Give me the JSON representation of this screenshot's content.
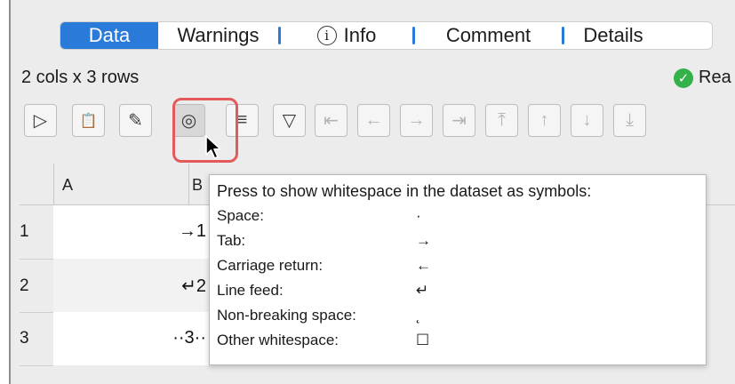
{
  "tabs": [
    {
      "label": "Data",
      "active": true
    },
    {
      "label": "Warnings",
      "active": false
    },
    {
      "label": "Info",
      "active": false
    },
    {
      "label": "Comment",
      "active": false
    },
    {
      "label": "Details",
      "active": false
    }
  ],
  "info_icon_glyph": "i",
  "table_info": "2 cols x 3 rows",
  "status": {
    "text": "Rea",
    "color": "#34b249"
  },
  "toolbar": {
    "buttons": [
      {
        "name": "run-icon",
        "glyph": "▷"
      },
      {
        "name": "paste-add-icon",
        "glyph": "📋"
      },
      {
        "name": "pencil-icon",
        "glyph": "✎"
      },
      {
        "name": "eye-icon",
        "glyph": "◎",
        "pressed": true
      },
      {
        "name": "sort-lines-icon",
        "glyph": "≡"
      },
      {
        "name": "filter-icon",
        "glyph": "▽"
      },
      {
        "name": "first-column-icon",
        "glyph": "⇤"
      },
      {
        "name": "left-arrow-icon",
        "glyph": "←"
      },
      {
        "name": "right-arrow-icon",
        "glyph": "→"
      },
      {
        "name": "last-column-icon",
        "glyph": "⇥"
      },
      {
        "name": "first-row-icon",
        "glyph": "⤒"
      },
      {
        "name": "up-arrow-icon",
        "glyph": "↑"
      },
      {
        "name": "down-arrow-icon",
        "glyph": "↓"
      },
      {
        "name": "last-row-icon",
        "glyph": "⤓"
      }
    ]
  },
  "columns": [
    "A",
    "B"
  ],
  "rows": [
    {
      "num": "1",
      "a": "→1"
    },
    {
      "num": "2",
      "a": "↵2"
    },
    {
      "num": "3",
      "a": "··3··"
    }
  ],
  "tooltip": {
    "heading": "Press to show whitespace in the dataset as symbols:",
    "entries": [
      {
        "label": "Space:",
        "symbol": "·"
      },
      {
        "label": "Tab:",
        "symbol": "→"
      },
      {
        "label": "Carriage return:",
        "symbol": "←"
      },
      {
        "label": "Line feed:",
        "symbol": "↵"
      },
      {
        "label": "Non-breaking space:",
        "symbol": "˛"
      },
      {
        "label": "Other whitespace:",
        "symbol": "☐"
      }
    ]
  },
  "colors": {
    "accent": "#2a7bd9",
    "highlight": "#e45a5a",
    "panel": "#ececec"
  }
}
